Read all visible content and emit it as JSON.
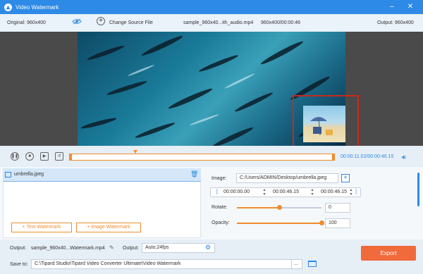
{
  "window": {
    "title": "Video Watermark"
  },
  "infobar": {
    "original_label": "Original: 960x400",
    "change_source_label": "Change Source File",
    "filename": "sample_960x40...ith_audio.mp4",
    "resolution_duration": "960x400/00:00:46",
    "output_label": "Output: 960x400"
  },
  "player": {
    "time_display": "00:00:11.02/00:00:46.15"
  },
  "watermark_list": {
    "items": [
      {
        "name": "umbrella.jpeg"
      }
    ],
    "add_text_label": "Text Watermark",
    "add_image_label": "Image Watermark"
  },
  "settings": {
    "image_label": "Image:",
    "image_path": "C:/Users/ADMIN/Desktop/umbrella.jpeg",
    "time_start": "00:00:00.00",
    "time_end": "00:00:46.15",
    "time_duration": "00:00:46.15",
    "rotate_label": "Rotate:",
    "rotate_value": "0",
    "rotate_level": 0.5,
    "opacity_label": "Opacity:",
    "opacity_value": "100",
    "opacity_level": 1.0
  },
  "bottom": {
    "output_label": "Output:",
    "output_file": "sample_960x40...Watermark.mp4",
    "output_format_label": "Output:",
    "output_format": "Auto;24fps",
    "save_to_label": "Save to:",
    "save_path": "C:\\Tipard Studio\\Tipard Video Converter Ultimate\\Video Watermark",
    "more_label": "...",
    "export_label": "Export"
  },
  "colors": {
    "accent": "#2d8ae6",
    "orange": "#f08c2e",
    "highlight": "#c8281e",
    "export": "#f06a3c"
  }
}
